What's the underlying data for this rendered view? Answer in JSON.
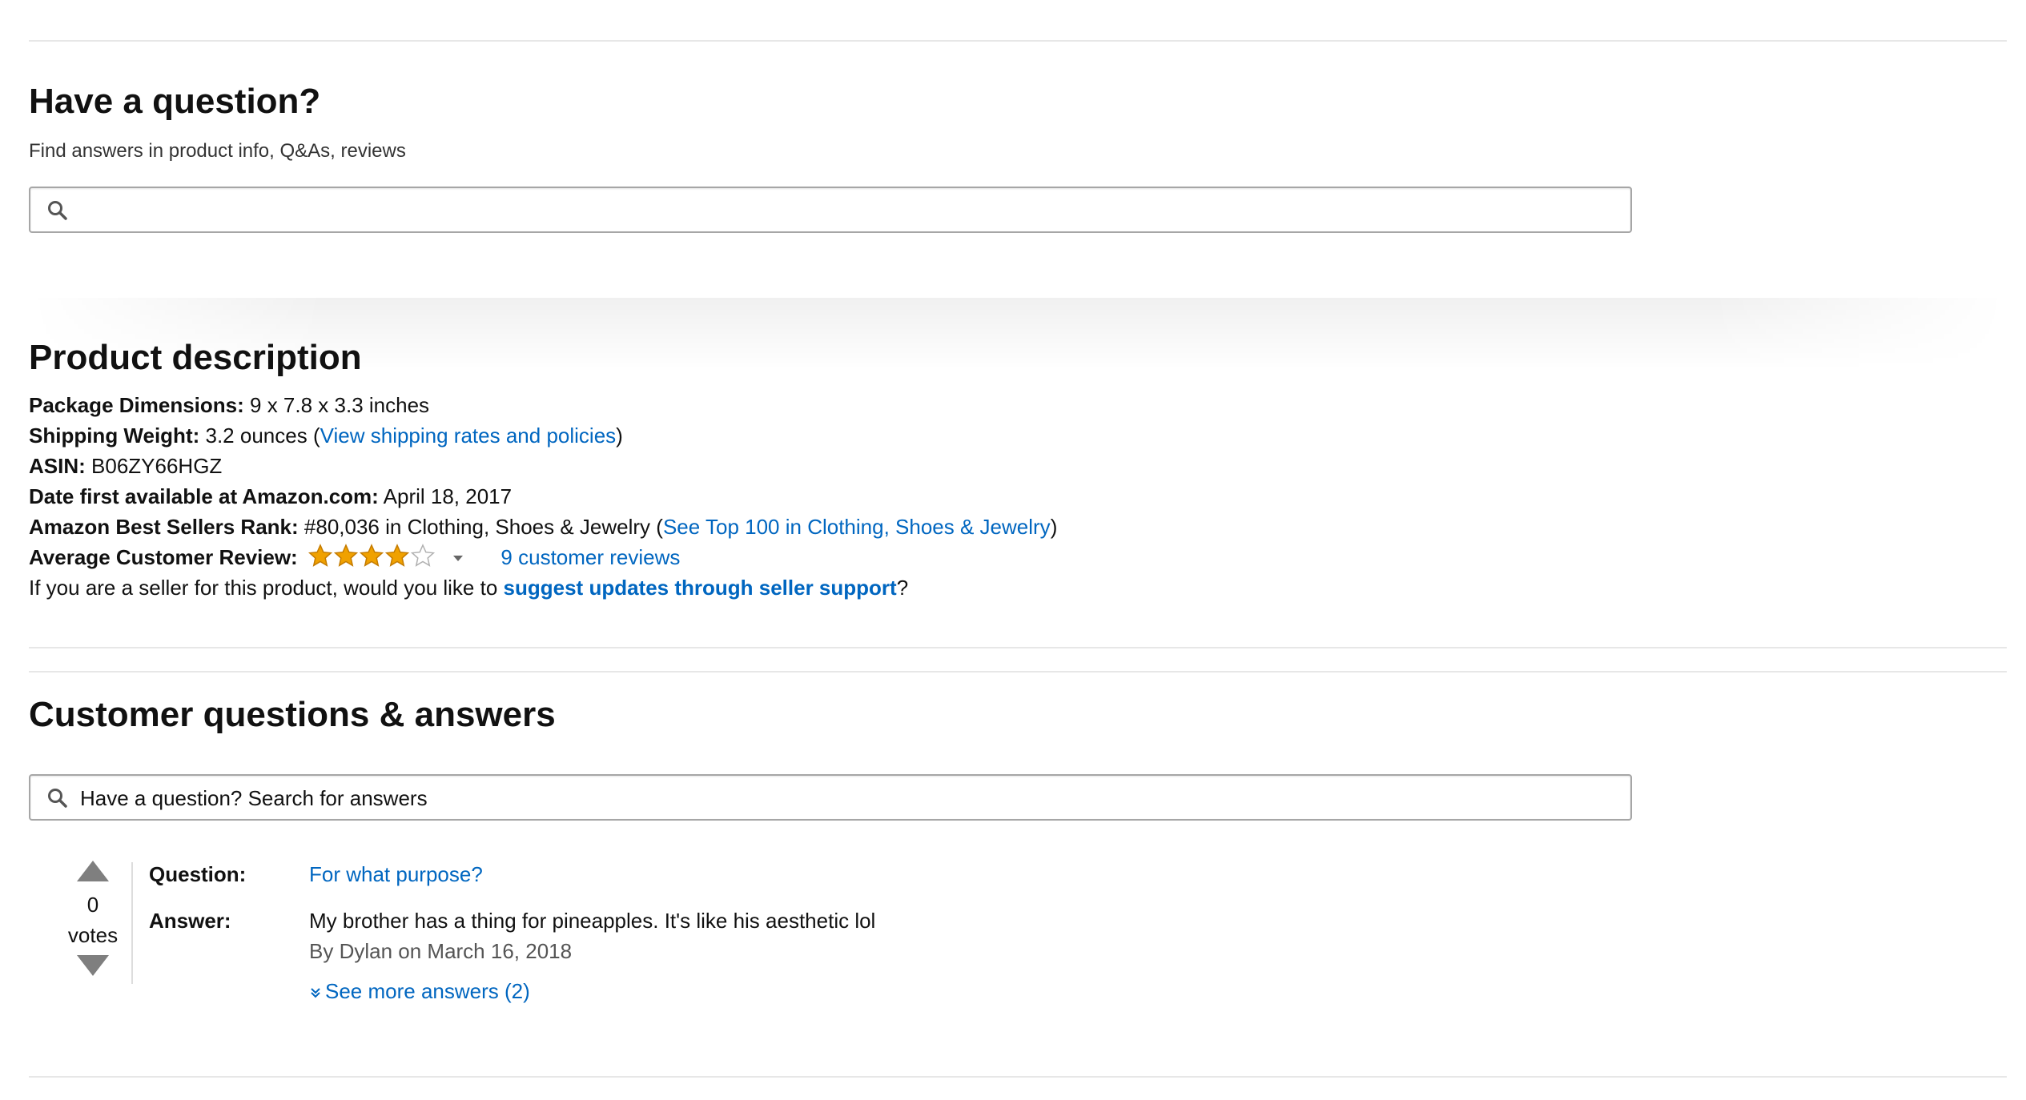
{
  "question_box": {
    "heading": "Have a question?",
    "subtext": "Find answers in product info, Q&As, reviews",
    "search_placeholder": "",
    "search_icon": "magnifier-icon"
  },
  "product_description": {
    "heading": "Product description",
    "package_dimensions_label": "Package Dimensions:",
    "package_dimensions_value": "9 x 7.8 x 3.3 inches",
    "shipping_weight_label": "Shipping Weight:",
    "shipping_weight_value": "3.2 ounces",
    "shipping_link": "View shipping rates and policies",
    "asin_label": "ASIN:",
    "asin_value": "B06ZY66HGZ",
    "date_label": "Date first available at Amazon.com:",
    "date_value": "April 18, 2017",
    "rank_label": "Amazon Best Sellers Rank:",
    "rank_value": "#80,036 in Clothing, Shoes & Jewelry",
    "rank_link": "See Top 100 in Clothing, Shoes & Jewelry",
    "review_label": "Average Customer Review:",
    "rating_stars": 4,
    "rating_max": 5,
    "star_color": "#f0a100",
    "reviews_link": "9 customer reviews",
    "seller_text_prefix": "If you are a seller for this product, would you like to",
    "seller_link": "suggest updates through seller support",
    "seller_text_suffix": "?"
  },
  "customer_qa": {
    "heading": "Customer questions & answers",
    "search_placeholder": "Have a question? Search for answers",
    "items": [
      {
        "votes": "0",
        "votes_label": "votes",
        "question_label": "Question:",
        "question": "For what purpose?",
        "answer_label": "Answer:",
        "answer": "My brother has a thing for pineapples. It's like his aesthetic lol",
        "byline": "By Dylan on March 16, 2018",
        "more_answers": "See more answers (2)"
      }
    ]
  },
  "colors": {
    "link": "#0066c0",
    "divider": "#e7e7e7",
    "text": "#111111"
  }
}
